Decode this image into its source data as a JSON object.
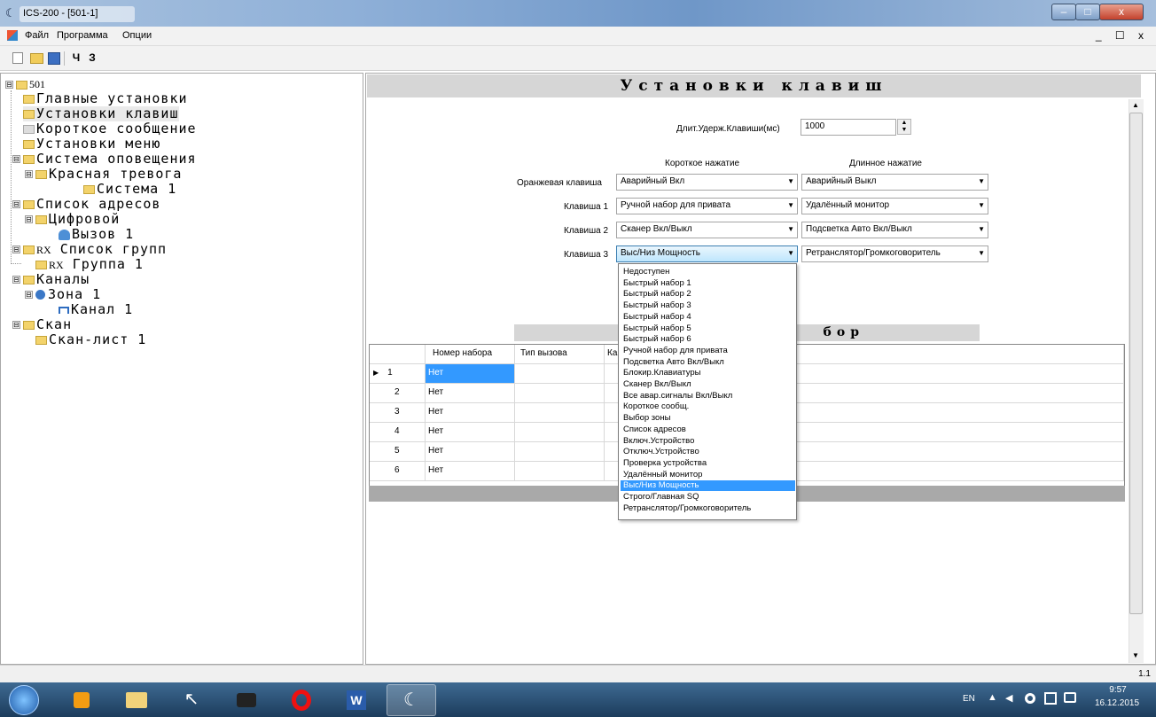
{
  "window": {
    "title": "ICS-200 - [501-1]",
    "app_icon": "crescent-icon",
    "min": "–",
    "max": "□",
    "close": "x"
  },
  "menu": {
    "items": [
      "Файл",
      "Программа",
      "Опции"
    ],
    "mdi_controls": "_ ☐ x"
  },
  "toolbar": {
    "icons": [
      "new-file-icon",
      "open-folder-icon",
      "save-icon"
    ],
    "read": "Ч",
    "write": "З"
  },
  "tree": {
    "root": "501",
    "nodes": [
      "Главные установки",
      "Установки клавиш",
      "Короткое сообщение",
      "Установки меню",
      "Система оповещения",
      "Красная тревога",
      "Система 1",
      "Список адресов",
      "Цифровой",
      "Вызов 1",
      "Список групп",
      "Группа 1",
      "Каналы",
      "Зона 1",
      "Канал 1",
      "Скан",
      "Скан-лист 1"
    ],
    "rx_tag": "RX",
    "expand": "⊟"
  },
  "panel": {
    "title": "Установки клавиш",
    "hold_label": "Длит.Удерж.Клавиши(мс)",
    "hold_value": "1000",
    "col_short": "Короткое нажатие",
    "col_long": "Длинное нажатие",
    "rows": [
      {
        "label": "Оранжевая клавиша",
        "short": "Аварийный Вкл",
        "long": "Аварийный Выкл"
      },
      {
        "label": "Клавиша 1",
        "short": "Ручной набор для привата",
        "long": "Удалённый монитор"
      },
      {
        "label": "Клавиша 2",
        "short": "Сканер Вкл/Выкл",
        "long": "Подсветка Авто Вкл/Выкл"
      },
      {
        "label": "Клавиша 3",
        "short": "Выс/Низ Мощность",
        "long": "Ретранслятор/Громкоговоритель"
      }
    ],
    "grid_title_tail": "бор",
    "grid_headers": [
      "Номер набора",
      "Тип вызова",
      "Ка"
    ],
    "grid_rows": [
      {
        "n": "1",
        "v": "Нет"
      },
      {
        "n": "2",
        "v": "Нет"
      },
      {
        "n": "3",
        "v": "Нет"
      },
      {
        "n": "4",
        "v": "Нет"
      },
      {
        "n": "5",
        "v": "Нет"
      },
      {
        "n": "6",
        "v": "Нет"
      }
    ],
    "row_marker": "▶"
  },
  "dropdown": {
    "items": [
      "Недоступен",
      "Быстрый набор 1",
      "Быстрый набор 2",
      "Быстрый набор 3",
      "Быстрый набор 4",
      "Быстрый набор 5",
      "Быстрый набор 6",
      "Ручной набор для привата",
      "Подсветка Авто Вкл/Выкл",
      "Блокир.Клавиатуры",
      "Сканер Вкл/Выкл",
      "Все авар.сигналы Вкл/Выкл",
      "Короткое сообщ.",
      "Выбор зоны",
      "Список адресов",
      "Включ.Устройство",
      "Отключ.Устройство",
      "Проверка устройства",
      "Удалённый монитор",
      "Выс/Низ Мощность",
      "Строго/Главная SQ",
      "Ретранслятор/Громкоговоритель"
    ],
    "selected_index": 19
  },
  "status": {
    "version": "1.1"
  },
  "taskbar": {
    "apps": [
      "start-orb-icon",
      "media-player-icon",
      "file-explorer-icon",
      "app-arrow-icon",
      "camera-icon",
      "opera-icon",
      "word-icon",
      "crescent-app-icon"
    ],
    "lang": "EN",
    "time": "9:57",
    "date": "16.12.2015"
  }
}
